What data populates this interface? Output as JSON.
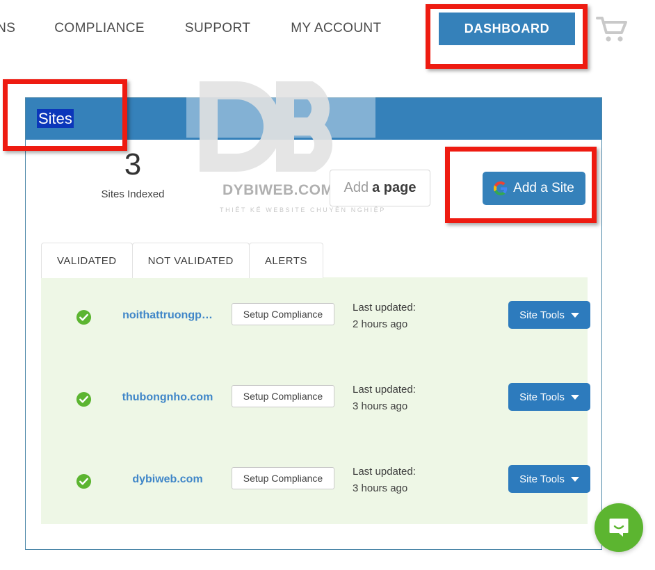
{
  "topnav": {
    "items": [
      {
        "label": "VNS",
        "name": "nav-item-domains-clipped"
      },
      {
        "label": "COMPLIANCE",
        "name": "nav-item-compliance"
      },
      {
        "label": "SUPPORT",
        "name": "nav-item-support"
      },
      {
        "label": "MY ACCOUNT",
        "name": "nav-item-my-account"
      }
    ],
    "dashboard_label": "DASHBOARD",
    "cart_icon": "shopping-cart-icon",
    "dashboard_color": "#3581ba"
  },
  "annotations": {
    "box_color": "#ee1b11",
    "boxes": [
      "dashboard-button",
      "sites-title",
      "add-a-site-button"
    ]
  },
  "panel": {
    "title": "Sites",
    "header_color": "#3581ba",
    "border_color": "#4c87a8"
  },
  "stats": {
    "count": "3",
    "label": "Sites Indexed"
  },
  "actions": {
    "add_page_light": "Add",
    "add_page_bold": "a page",
    "add_site_label": "Add a Site",
    "add_site_icon": "google-g-icon",
    "add_site_color": "#3581ba"
  },
  "tabs": [
    {
      "label": "VALIDATED",
      "name": "tab-validated"
    },
    {
      "label": "NOT VALIDATED",
      "name": "tab-not-validated"
    },
    {
      "label": "ALERTS",
      "name": "tab-alerts"
    }
  ],
  "site_list": {
    "background": "#eef7e6",
    "status_icon": "green-check-circle-icon",
    "setup_label": "Setup Compliance",
    "tools_label": "Site Tools",
    "tools_icon": "chevron-down-icon",
    "updated_label": "Last updated:",
    "rows": [
      {
        "name": "noithattruongp…",
        "updated": "2 hours ago"
      },
      {
        "name": "thubongnho.com",
        "updated": "3 hours ago"
      },
      {
        "name": "dybiweb.com",
        "updated": "3 hours ago"
      }
    ]
  },
  "watermark": {
    "brand": "DYBIWEB.COM",
    "tagline": "THIẾT KẾ WEBSITE CHUYÊN NGHIỆP",
    "logo": "db-monogram-logo"
  },
  "chat": {
    "icon": "chat-bubble-smile-icon",
    "color": "#5cb530"
  }
}
